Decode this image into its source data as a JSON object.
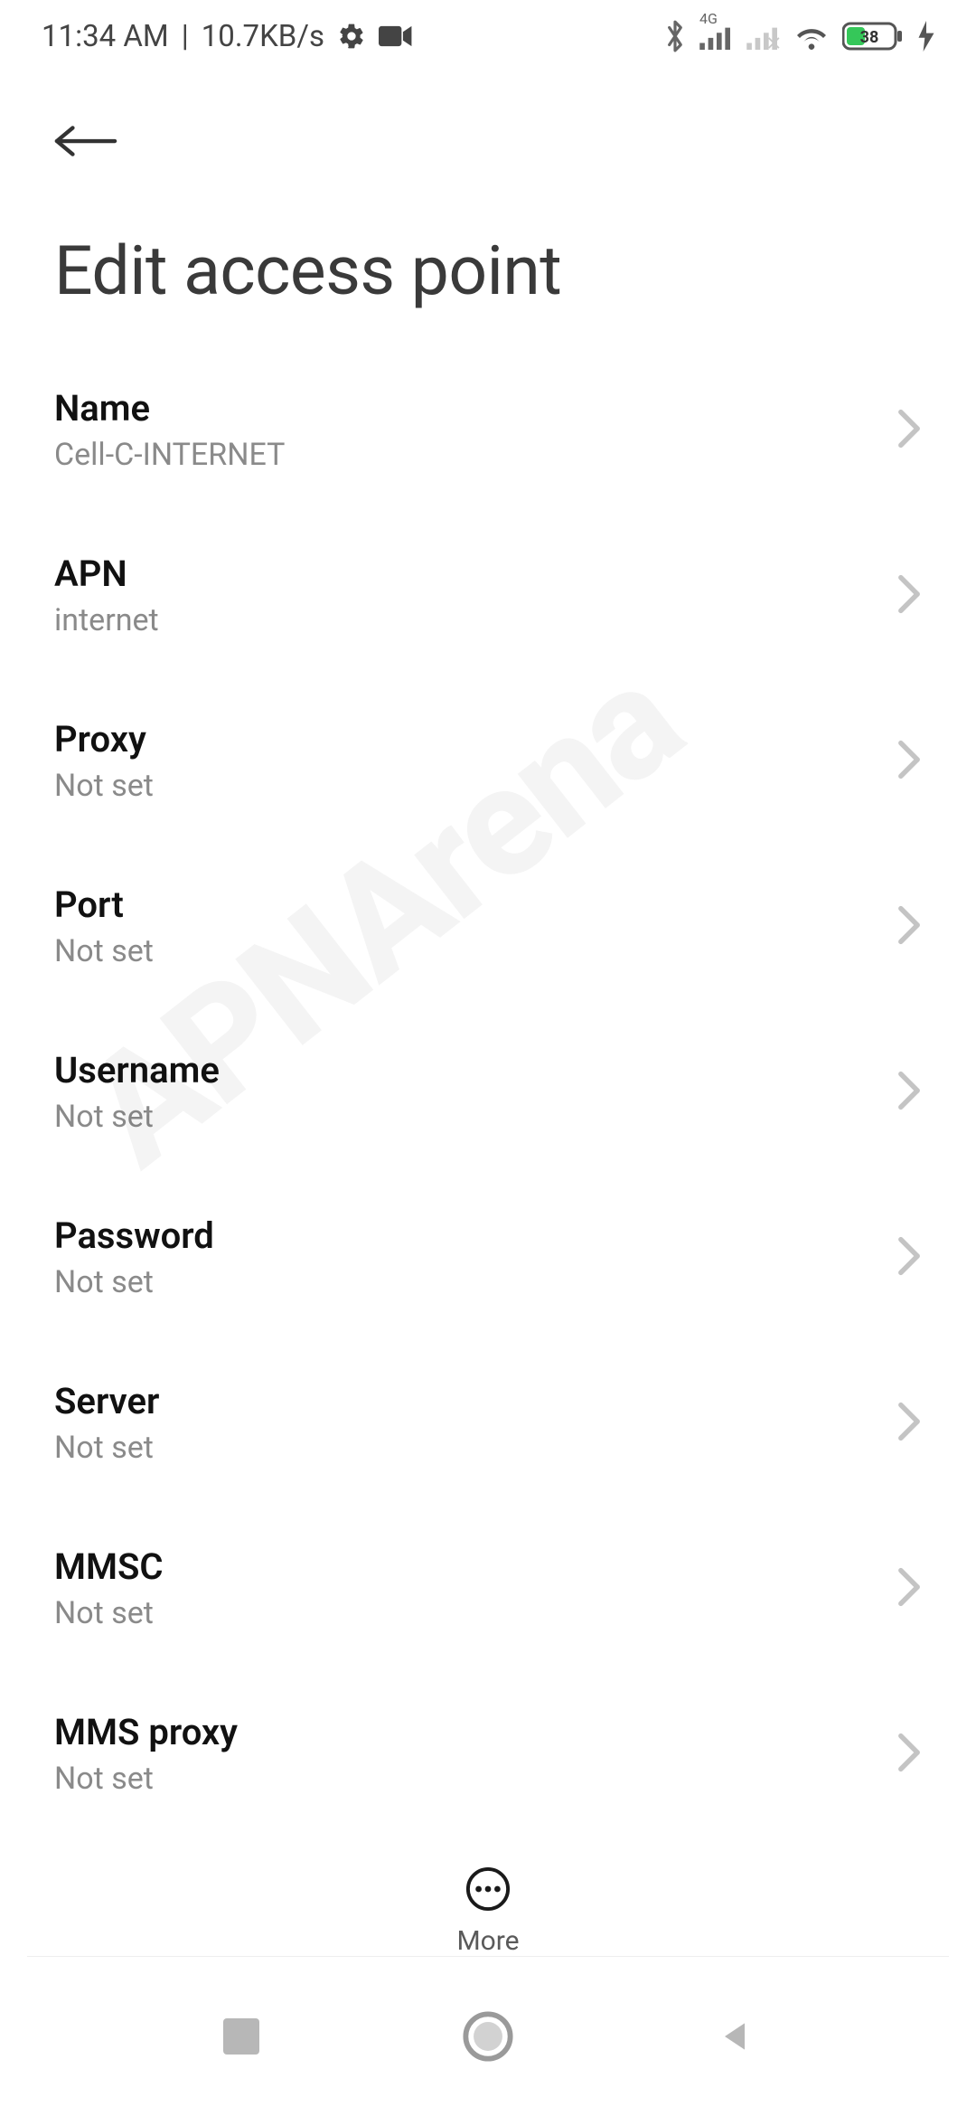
{
  "status_bar": {
    "time": "11:34 AM",
    "sep": "|",
    "speed": "10.7KB/s",
    "network_badge": "4G",
    "battery_level": "38"
  },
  "header": {
    "title": "Edit access point"
  },
  "rows": [
    {
      "label": "Name",
      "value": "Cell-C-INTERNET"
    },
    {
      "label": "APN",
      "value": "internet"
    },
    {
      "label": "Proxy",
      "value": "Not set"
    },
    {
      "label": "Port",
      "value": "Not set"
    },
    {
      "label": "Username",
      "value": "Not set"
    },
    {
      "label": "Password",
      "value": "Not set"
    },
    {
      "label": "Server",
      "value": "Not set"
    },
    {
      "label": "MMSC",
      "value": "Not set"
    },
    {
      "label": "MMS proxy",
      "value": "Not set"
    }
  ],
  "more": {
    "label": "More"
  },
  "watermark": "APNArena"
}
